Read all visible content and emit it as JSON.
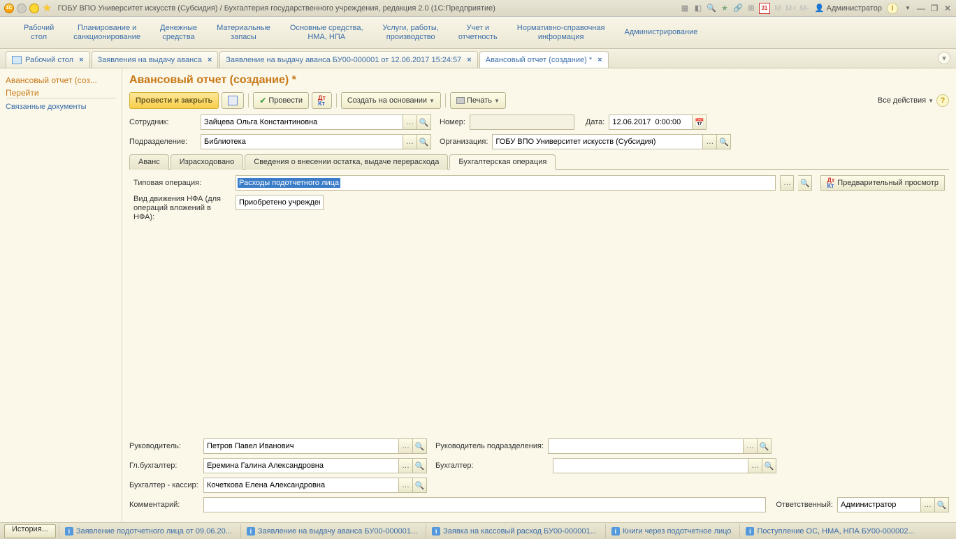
{
  "titlebar": {
    "title": "ГОБУ ВПО Университет искусств (Субсидия) / Бухгалтерия государственного учреждения, редакция 2.0  (1С:Предприятие)",
    "user": "Администратор",
    "m_labels": [
      "M",
      "M+",
      "M-"
    ]
  },
  "mainmenu": [
    "Рабочий\nстол",
    "Планирование и\nсанкционирование",
    "Денежные\nсредства",
    "Материальные\nзапасы",
    "Основные средства,\nНМА, НПА",
    "Услуги, работы,\nпроизводство",
    "Учет и\nотчетность",
    "Нормативно-справочная\nинформация",
    "Администрирование"
  ],
  "doctabs": [
    {
      "label": "Рабочий стол",
      "closable": true,
      "icon": true
    },
    {
      "label": "Заявления на выдачу аванса",
      "closable": true
    },
    {
      "label": "Заявление на выдачу аванса БУ00-000001 от 12.06.2017 15:24:57",
      "closable": true
    },
    {
      "label": "Авансовый отчет (создание) *",
      "closable": true,
      "active": true
    }
  ],
  "nav": {
    "heading": "Авансовый отчет (соз...",
    "header2": "Перейти",
    "links": [
      "Связанные документы"
    ]
  },
  "form": {
    "title": "Авансовый отчет (создание) *",
    "cmd": {
      "post_close": "Провести и закрыть",
      "provesti": "Провести",
      "create_based": "Создать на основании",
      "print": "Печать",
      "all_actions": "Все действия"
    },
    "f1": {
      "employee_l": "Сотрудник:",
      "employee_v": "Зайцева Ольга Константиновна",
      "number_l": "Номер:",
      "number_v": "",
      "date_l": "Дата:",
      "date_v": "12.06.2017  0:00:00"
    },
    "f2": {
      "dept_l": "Подразделение:",
      "dept_v": "Библиотека",
      "org_l": "Организация:",
      "org_v": "ГОБУ ВПО Университет искусств (Субсидия)"
    },
    "subtabs": [
      "Аванс",
      "Израсходовано",
      "Сведения о внесении остатка, выдаче перерасхода",
      "Бухгалтерская операция"
    ],
    "subtab_active": 3,
    "tc": {
      "typop_l": "Типовая операция:",
      "typop_v": "Расходы подотчетного лица",
      "preview": "Предварительный просмотр",
      "nfa_l": "Вид движения НФА (для\nопераций вложений в НФА):",
      "nfa_v": "Приобретено учреждени"
    },
    "bot": {
      "head_l": "Руководитель:",
      "head_v": "Петров Павел Иванович",
      "headdept_l": "Руководитель подразделения:",
      "headdept_v": "",
      "chief_l": "Гл.бухгалтер:",
      "chief_v": "Еремина Галина Александровна",
      "acc_l": "Бухгалтер:",
      "acc_v": "",
      "cashier_l": "Бухгалтер - кассир:",
      "cashier_v": "Кочеткова Елена Александровна",
      "comment_l": "Комментарий:",
      "comment_v": "",
      "resp_l": "Ответственный:",
      "resp_v": "Администратор"
    }
  },
  "status": {
    "history": "История...",
    "links": [
      "Заявление подотчетного лица от 09.06.20...",
      "Заявление на выдачу аванса БУ00-000001...",
      "Заявка на кассовый расход БУ00-000001...",
      "Книги через подотчетное лицо",
      "Поступление ОС, НМА, НПА БУ00-000002..."
    ]
  }
}
